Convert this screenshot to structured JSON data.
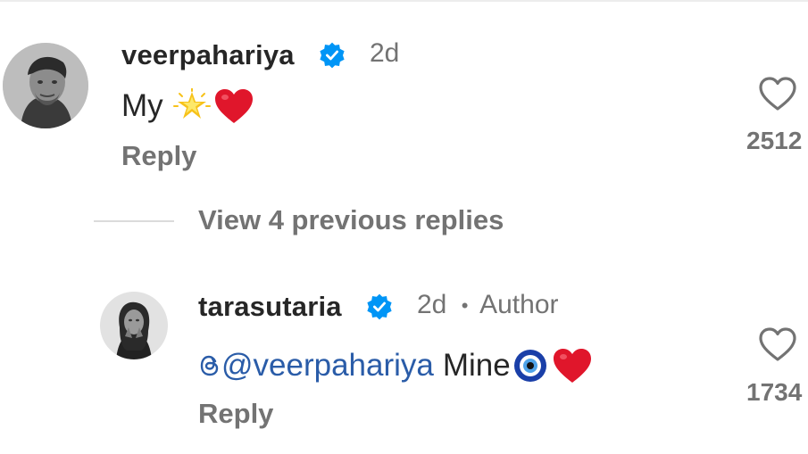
{
  "comment": {
    "username": "veerpahariya",
    "time": "2d",
    "text": "My",
    "reply_label": "Reply",
    "likes": "2512"
  },
  "view_replies_label": "View 4 previous replies",
  "reply_comment": {
    "username": "tarasutaria",
    "time": "2d",
    "separator": "•",
    "author_badge": "Author",
    "mention": "@veerpahariya",
    "text": "Mine",
    "reply_label": "Reply",
    "likes": "1734"
  },
  "icons": {
    "verified": "verified-badge-icon",
    "heart": "heart-outline-icon",
    "star_emoji": "glowing-star-emoji",
    "heart_emoji": "red-heart-emoji",
    "nazar_emoji": "nazar-amulet-emoji",
    "threads": "threads-logo-icon"
  },
  "colors": {
    "verified_blue": "#0095f6",
    "mention_blue": "#2a5ca8",
    "muted_gray": "#737373",
    "text_dark": "#262626",
    "heart_red": "#e0162b"
  }
}
